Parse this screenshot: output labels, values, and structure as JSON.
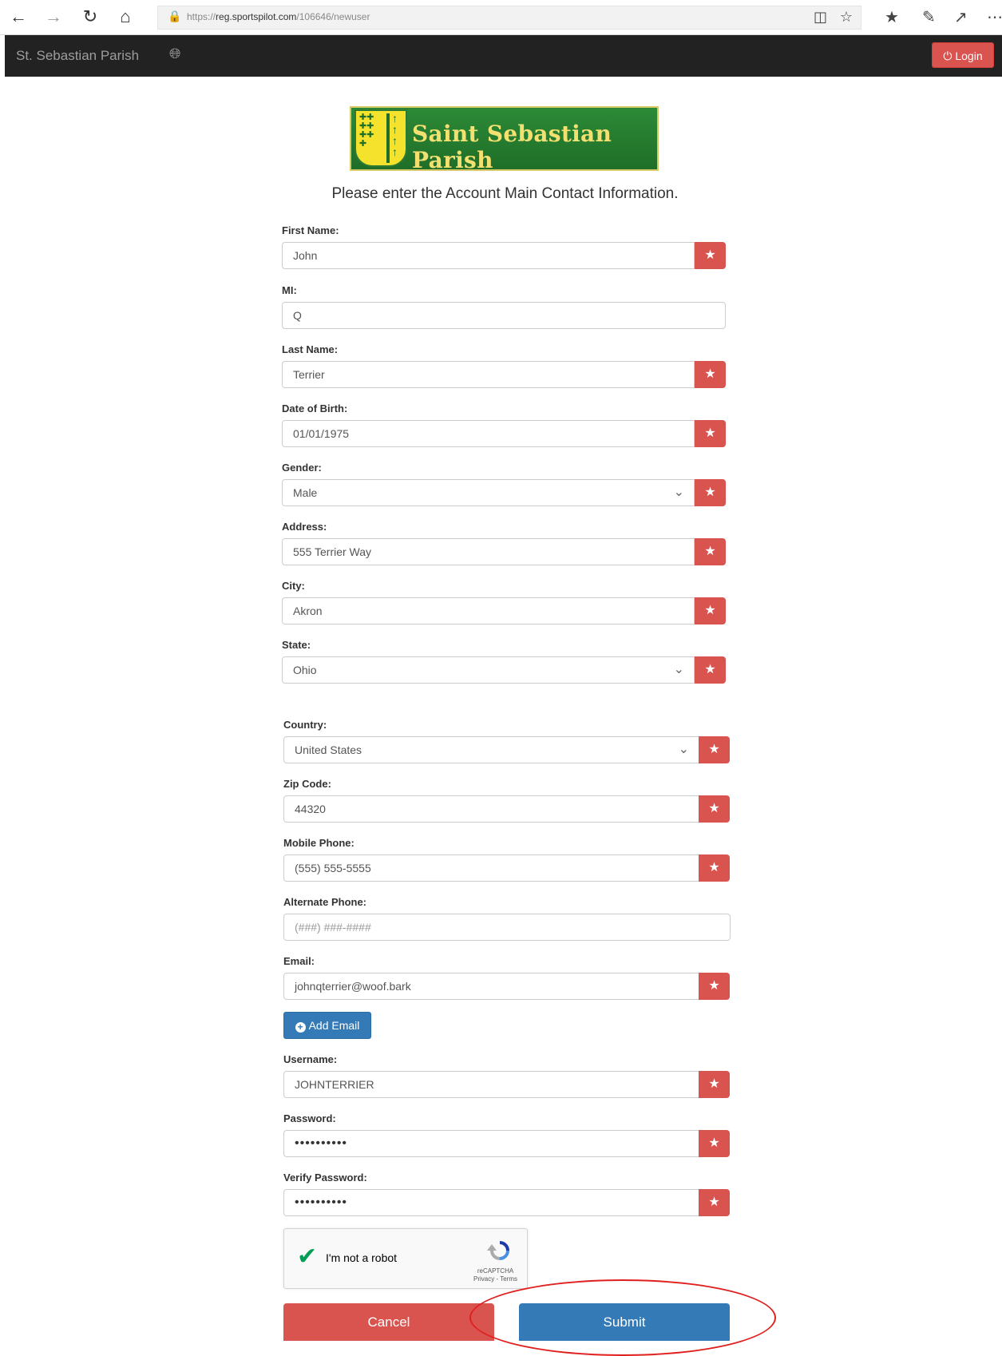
{
  "browser": {
    "url_prefix": "https://",
    "url_domain": "reg.sportspilot.com",
    "url_path": "/106646/newuser"
  },
  "navbar": {
    "brand": "St. Sebastian Parish",
    "login_label": "Login"
  },
  "logo": {
    "title": "Saint Sebastian Parish"
  },
  "intro": "Please enter the Account Main Contact Information.",
  "form": {
    "first_name": {
      "label": "First Name:",
      "value": "John"
    },
    "mi": {
      "label": "MI:",
      "value": "Q"
    },
    "last_name": {
      "label": "Last Name:",
      "value": "Terrier"
    },
    "dob": {
      "label": "Date of Birth:",
      "value": "01/01/1975"
    },
    "gender": {
      "label": "Gender:",
      "value": "Male"
    },
    "address": {
      "label": "Address:",
      "value": "555 Terrier Way"
    },
    "city": {
      "label": "City:",
      "value": "Akron"
    },
    "state": {
      "label": "State:",
      "value": "Ohio"
    },
    "country": {
      "label": "Country:",
      "value": "United States"
    },
    "zip": {
      "label": "Zip Code:",
      "value": "44320"
    },
    "mobile": {
      "label": "Mobile Phone:",
      "value": "(555) 555-5555"
    },
    "alt_phone": {
      "label": "Alternate Phone:",
      "placeholder": "(###) ###-####"
    },
    "email": {
      "label": "Email:",
      "value": "johnqterrier@woof.bark"
    },
    "add_email_label": "Add Email",
    "username": {
      "label": "Username:",
      "value": "JOHNTERRIER"
    },
    "password": {
      "label": "Password:",
      "value": "••••••••••"
    },
    "verify_password": {
      "label": "Verify Password:",
      "value": "••••••••••"
    }
  },
  "captcha": {
    "label": "I'm not a robot",
    "brand": "reCAPTCHA",
    "links": "Privacy - Terms"
  },
  "buttons": {
    "cancel": "Cancel",
    "submit": "Submit"
  },
  "colors": {
    "required": "#d9534f",
    "primary": "#337ab7",
    "navbar": "#222222",
    "annotation": "#e0201f"
  }
}
